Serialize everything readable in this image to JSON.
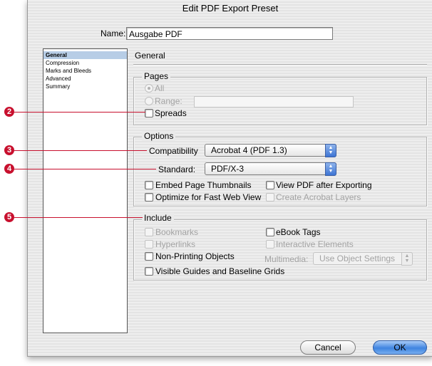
{
  "dialog": {
    "title": "Edit PDF Export Preset"
  },
  "name_field": {
    "label": "Name:",
    "value": "Ausgabe PDF"
  },
  "sidebar": {
    "items": [
      {
        "label": "General",
        "selected": true
      },
      {
        "label": "Compression",
        "selected": false
      },
      {
        "label": "Marks and Bleeds",
        "selected": false
      },
      {
        "label": "Advanced",
        "selected": false
      },
      {
        "label": "Summary",
        "selected": false
      }
    ]
  },
  "panel": {
    "title": "General"
  },
  "pages": {
    "group_label": "Pages",
    "all_label": "All",
    "range_label": "Range:",
    "range_value": "",
    "spreads_label": "Spreads"
  },
  "options": {
    "group_label": "Options",
    "compatibility_label": "Compatibility",
    "compatibility_value": "Acrobat 4 (PDF 1.3)",
    "standard_label": "Standard:",
    "standard_value": "PDF/X-3",
    "embed_thumbnails": "Embed Page Thumbnails",
    "view_after_export": "View PDF after Exporting",
    "optimize_web": "Optimize for Fast Web View",
    "create_layers": "Create Acrobat Layers"
  },
  "include": {
    "group_label": "Include",
    "bookmarks": "Bookmarks",
    "ebook_tags": "eBook Tags",
    "hyperlinks": "Hyperlinks",
    "interactive_elements": "Interactive Elements",
    "non_printing": "Non-Printing Objects",
    "multimedia_label": "Multimedia:",
    "multimedia_value": "Use Object Settings",
    "visible_guides": "Visible Guides and Baseline Grids"
  },
  "buttons": {
    "cancel": "Cancel",
    "ok": "OK"
  },
  "callouts": [
    "2",
    "3",
    "4",
    "5"
  ],
  "colors": {
    "callout": "#c8102e",
    "selection": "#b7cde6",
    "ok_button": "#3f84e0"
  }
}
